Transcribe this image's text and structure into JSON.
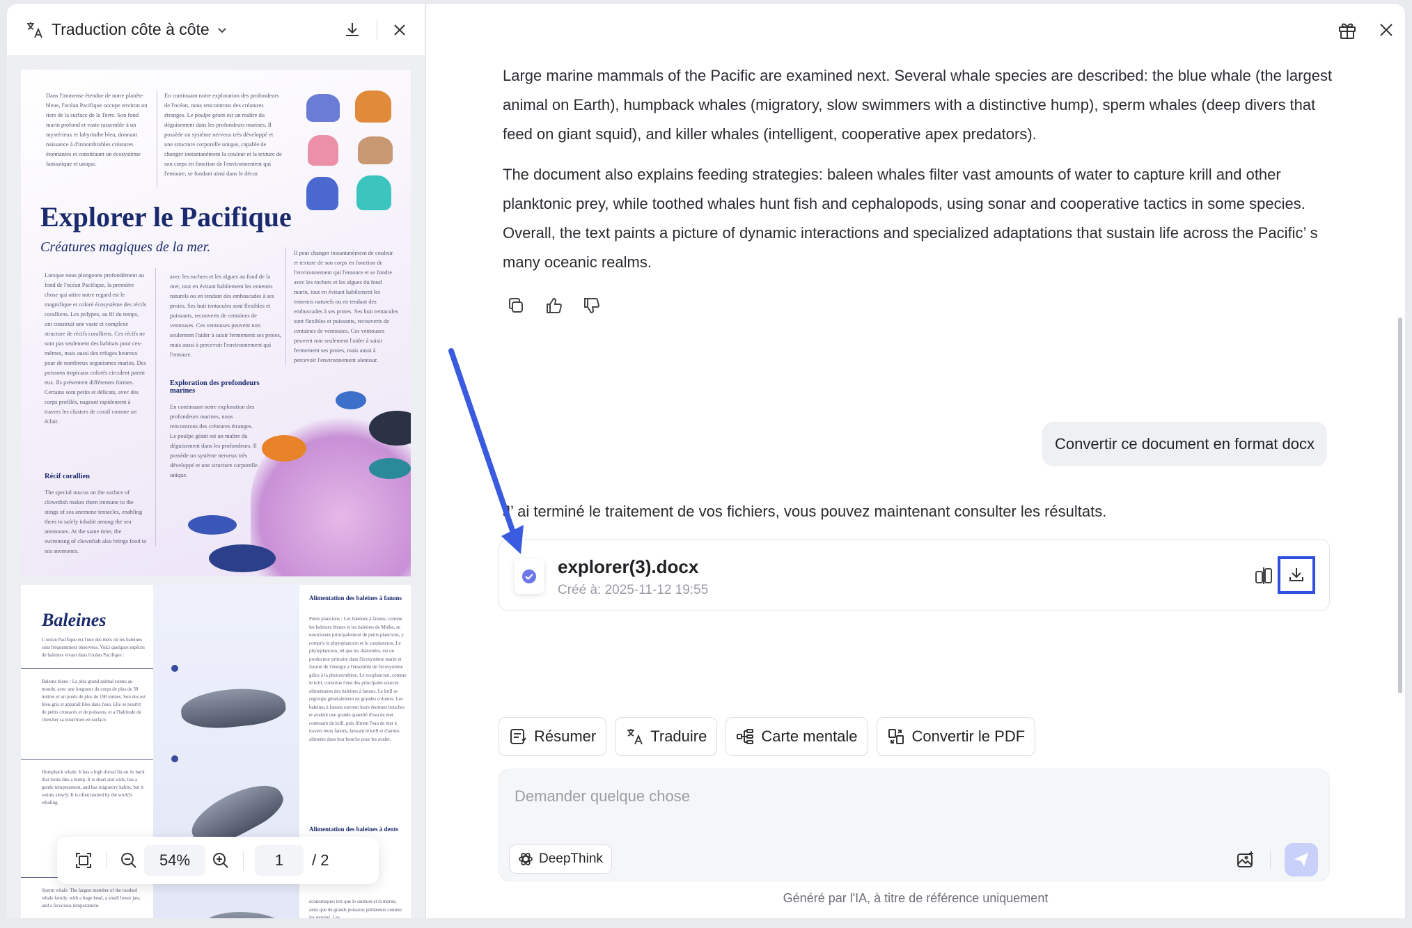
{
  "left_panel": {
    "title": "Traduction côte à côte",
    "page1": {
      "title": "Explorer le Pacifique",
      "subtitle": "Créatures magiques de la mer.",
      "col_a_top": "Dans l'immense étendue de notre planète bleue, l'océan Pacifique occupe environ un tiers de la surface de la Terre. Son fond marin profond et vaste rassemble à un mystérieux et labyrinthe bleu, donnant naissance à d'innombrables créatures étonnantes et constituant un écosystème fantastique et unique.",
      "col_b_top": "En continuant notre exploration des profondeurs de l'océan, nous rencontrons des créatures étranges. Le poulpe géant est un maître du déguisement dans les profondeurs marines. Il possède un système nerveux très développé et une structure corporelle unique, capable de changer instantanément la couleur et la texture de son corps en fonction de l'environnement qui l'entoure, se fondant ainsi dans le décor.",
      "col_a_mid": "Lorsque nous plongeons profondément au fond de l'océan Pacifique, la première chose qui attire notre regard est le magnifique et coloré écosystème des récifs coralliens. Les polypes, au fil du temps, ont construit une vaste et complexe structure de récifs coralliens. Ces récifs ne sont pas seulement des habitats pour ces-mêmes, mais aussi des refuges heureux pour de nombreux organismes marins. Des poissons tropicaux colorés circulent parmi eux. Ils présentent différentes formes. Certains sont petits et délicats, avec des corps profilés, nageant rapidement à travers les clusters de corail comme un éclair.",
      "col_b_mid": "avec les rochers et les algues au fond de la mer, tout en évitant habilement les ennemis naturels ou en tendant des embuscades à ses proies. Ses huit tentacules sont flexibles et puissants, recouverts de centaines de ventouses. Ces ventouses peuvent non seulement l'aider à saisir fermement ses proies, mais aussi à percevoir l'environnement qui l'entoure.",
      "col_c_mid": "Il peut changer instantanément de couleur et texture de son corps en fonction de l'environnement qui l'entoure et se fondre avec les rochers et les algues du fond marin, tout en évitant habilement les ennemis naturels ou en tendant des embuscades à ses proies. Ses huit tentacules sont flexibles et puissants, recouverts de centaines de ventouses. Ces ventouses peuvent non seulement l'aider à saisir fermement ses proies, mais aussi à percevoir l'environnement alentour.",
      "head_profondeurs": "Exploration des profondeurs marines",
      "col_b_low": "En continuant notre exploration des profondeurs marines, nous rencontrons des créatures étranges. Le poulpe géant est un maître du déguisement dans les profondeurs. Il possède un système nerveux très développé et une structure corporelle unique.",
      "head_recif": "Récif corallien",
      "col_a_low": "The special mucus on the surface of clownfish makes them immune to the stings of sea anemone tentacles, enabling them to safely inhabit among the sea anemones. At the same time, the swimming of clownfish also brings food to sea anemones."
    },
    "page2": {
      "title": "Baleines",
      "intro": "L'océan Pacifique est l'une des mers où les baleines sont fréquemment observées. Voici quelques espèces de baleines vivant dans l'océan Pacifique :",
      "item1": "Baleine bleue : La plus grand animal connu au monde, avec une longueur du corps de plus de 30 mètres et un poids de plus de 190 tonnes. Son dos est bleu-gris et apparaît bleu dans l'eau. Elle se nourrit de petits crustacés et de poissons, et a l'habitude de chercher sa nourriture en surface.",
      "item2": "Humpback whale: It has a high dorsal fin on its back that looks like a hump. It is short and wide, has a gentle temperament, and has migratory habits, but it swims slowly. It is often hunted by the world's whaling.",
      "item3": "Sperm whale: The largest member of the toothed whale family, with a huge head, a small lower jaw, and a ferocious temperament.",
      "head_fanons": "Alimentation des baleines à fanons",
      "fanons": "Petits planctons : Les baleines à fanons, comme les baleines bleues et les baleines de Minke, se nourrissent principalement de petits planctons, y compris le phytoplancton et le zooplancton. Le phytoplancton, tel que les diatomées, est un producteur primaire dans l'écosystème marin et fournit de l'énergie à l'ensemble de l'écosystème grâce à la photosynthèse. Le zooplancton, comme le krill, constitue l'une des principales sources alimentaires des baleines à fanons. Le krill se regroupe généralement en grandes colonies. Les baleines à fanons ouvrent leurs énormes bouches et avalent une grande quantité d'eau de mer contenant du krill, puis filtrent l'eau de mer à travers leurs fanons, laissant le krill et d'autres aliments dans leur bouche pour les avaler.",
      "head_dents": "Alimentation des baleines à dents",
      "dents": "économiques tels que le saumon et la morue, ainsi que de grands poissons prédateurs comme les requins. Les"
    },
    "zoom": {
      "value": "54%",
      "page_current": "1",
      "page_total": "/ 2"
    }
  },
  "chat": {
    "paragraph1": "Large marine mammals of the Pacific are examined next. Several whale species are described: the blue whale (the largest animal on Earth), humpback whales (migratory, slow swimmers with a distinctive hump), sperm whales (deep divers that feed on giant squid), and killer whales (intelligent, cooperative apex predators).",
    "paragraph2": "The document also explains feeding strategies: baleen whales filter vast amounts of water to capture krill and other planktonic prey, while toothed whales hunt fish and cephalopods, using sonar and cooperative tactics in some species. Overall, the text paints a picture of dynamic interactions and specialized adaptations that sustain life across the Pacific’ s many oceanic realms.",
    "user_message": "Convertir ce document en format docx",
    "ai_message": "J’ ai terminé le traitement de vos fichiers, vous pouvez maintenant consulter les résultats.",
    "file": {
      "name": "explorer(3).docx",
      "created": "Créé à: 2025-11-12 19:55"
    },
    "chips": [
      "Résumer",
      "Traduire",
      "Carte mentale",
      "Convertir le PDF"
    ],
    "input_placeholder": "Demander quelque chose",
    "deepthink_label": "DeepThink",
    "footer": "Généré par l'IA, à titre de référence uniquement"
  },
  "colors": {
    "accent": "#2f4fe0",
    "send_disabled": "#c9d1fb",
    "title_navy": "#1a2a6c"
  },
  "icons": [
    "translate-icon",
    "chevron-down-icon",
    "download-icon",
    "close-icon",
    "gift-icon",
    "copy-icon",
    "thumbs-up-icon",
    "thumbs-down-icon",
    "check-circle-icon",
    "compare-icon",
    "fit-page-icon",
    "zoom-out-icon",
    "zoom-in-icon",
    "summarize-icon",
    "mind-map-icon",
    "convert-icon",
    "deepthink-icon",
    "image-upload-icon",
    "send-icon"
  ]
}
